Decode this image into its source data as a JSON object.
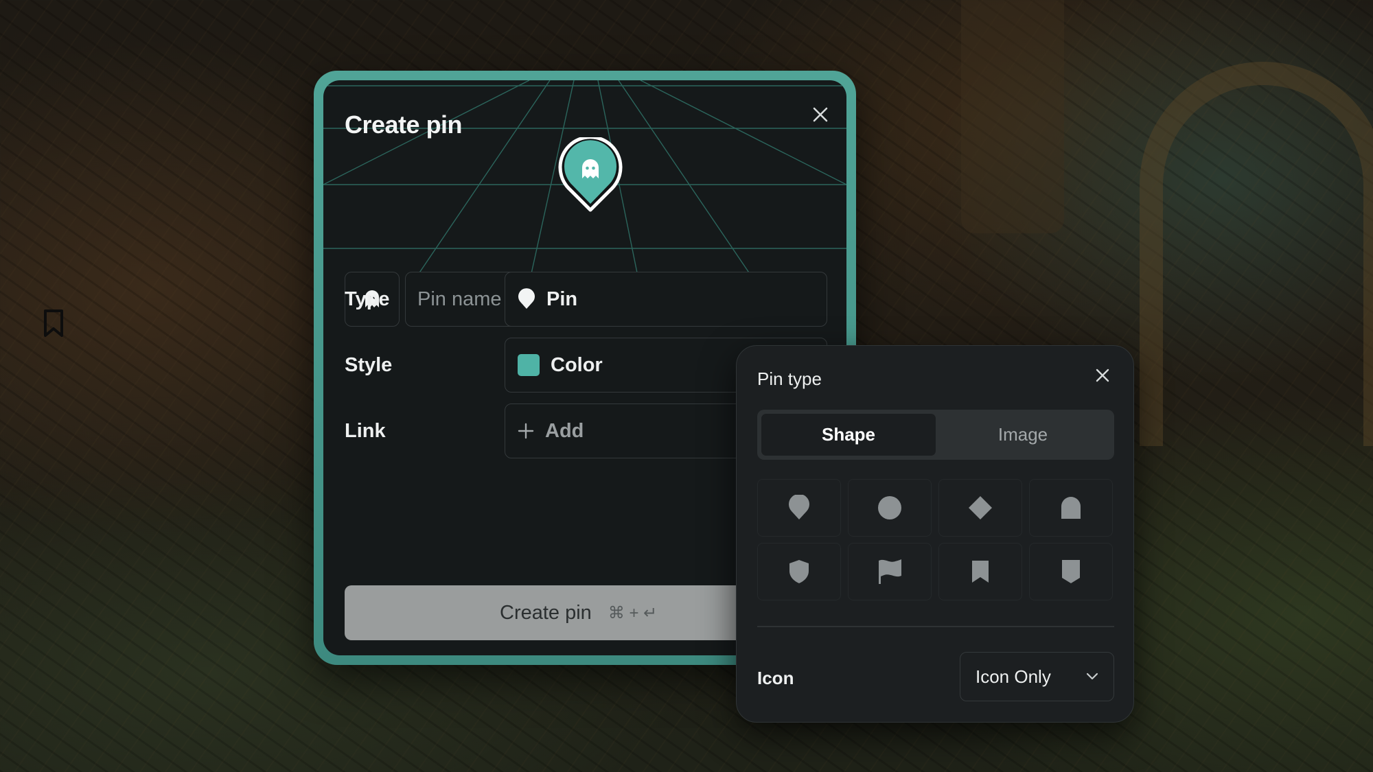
{
  "modal": {
    "title": "Create pin",
    "name_placeholder": "Pin name",
    "rows": {
      "type_label": "Type",
      "type_value": "Pin",
      "style_label": "Style",
      "style_value": "Color",
      "link_label": "Link",
      "link_value": "Add"
    },
    "create_button": "Create pin",
    "shortcut": "⌘ + ↵",
    "accent_color": "#4fb3a6"
  },
  "popover": {
    "title": "Pin type",
    "tabs": [
      "Shape",
      "Image"
    ],
    "active_tab": "Shape",
    "shapes": [
      "pin",
      "circle",
      "diamond",
      "arch",
      "shield",
      "flag",
      "bookmark",
      "banner"
    ],
    "icon_label": "Icon",
    "icon_select_value": "Icon Only"
  }
}
